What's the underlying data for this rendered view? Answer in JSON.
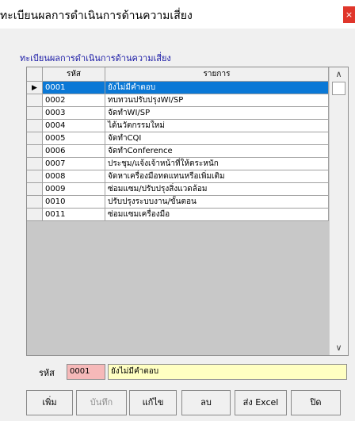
{
  "window": {
    "title": "ทะเบียนผลการดำเนินการด้านความเสี่ยง",
    "close_glyph": "×"
  },
  "section_title": "ทะเบียนผลการดำเนินการด้านความเสี่ยง",
  "grid": {
    "columns": [
      "รหัส",
      "รายการ"
    ],
    "selected_marker": "▶",
    "rows": [
      {
        "code": "0001",
        "name": "ยังไม่มีคำตอบ"
      },
      {
        "code": "0002",
        "name": "ทบทวนปรับปรุงWI/SP"
      },
      {
        "code": "0003",
        "name": "จัดทำWI/SP"
      },
      {
        "code": "0004",
        "name": "ได้นวัตกรรมใหม่"
      },
      {
        "code": "0005",
        "name": "จัดทำCQI"
      },
      {
        "code": "0006",
        "name": "จัดทำConference"
      },
      {
        "code": "0007",
        "name": "ประชุม/แจ้งเจ้าหน้าที่ให้ตระหนัก"
      },
      {
        "code": "0008",
        "name": "จัดหาเครื่องมือทดแทนหรือเพิ่มเติม"
      },
      {
        "code": "0009",
        "name": "ซ่อมแซม/ปรับปรุงสิ่งแวดล้อม"
      },
      {
        "code": "0010",
        "name": "ปรับปรุงระบบงาน/ขั้นตอน"
      },
      {
        "code": "0011",
        "name": "ซ่อมแซมเครื่องมือ"
      }
    ]
  },
  "form": {
    "code_label": "รหัส",
    "code_value": "0001",
    "name_value": "ยังไม่มีคำตอบ"
  },
  "buttons": {
    "add": "เพิ่ม",
    "save": "บันทึก",
    "edit": "แก้ไข",
    "delete": "ลบ",
    "export": "ส่ง Excel",
    "close": "ปิด"
  }
}
